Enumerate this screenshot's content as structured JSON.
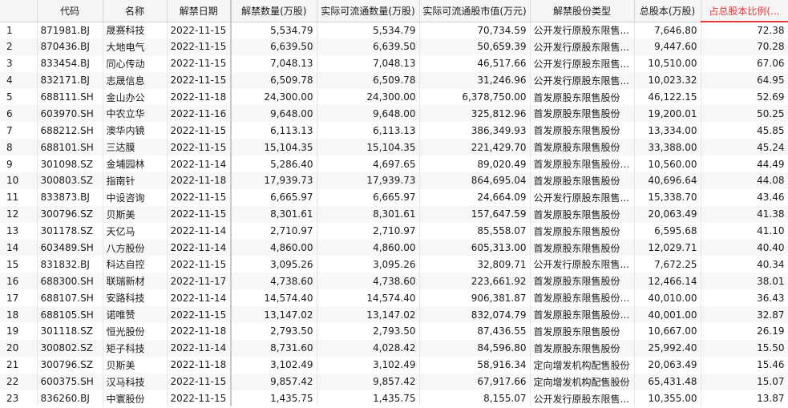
{
  "headers": [
    "",
    "代码",
    "名称",
    "解禁日期",
    "解禁数量(万股)",
    "实际可流通数量(万股)",
    "实际可流通股市值(万元)",
    "解禁股份类型",
    "总股本(万股)",
    "占总股本比例(..."
  ],
  "rows": [
    [
      "1",
      "871981.BJ",
      "晟赛科技",
      "2022-11-15",
      "5,534.79",
      "5,534.79",
      "70,734.59",
      "公开发行原股东限售...",
      "7,646.80",
      "72.38"
    ],
    [
      "2",
      "870436.BJ",
      "大地电气",
      "2022-11-15",
      "6,639.50",
      "6,639.50",
      "50,659.39",
      "公开发行原股东限售...",
      "9,447.60",
      "70.28"
    ],
    [
      "3",
      "833454.BJ",
      "同心传动",
      "2022-11-15",
      "7,048.13",
      "7,048.13",
      "46,517.66",
      "公开发行原股东限售...",
      "10,510.00",
      "67.06"
    ],
    [
      "4",
      "832171.BJ",
      "志晟信息",
      "2022-11-15",
      "6,509.78",
      "6,509.78",
      "31,246.96",
      "公开发行原股东限售...",
      "10,023.32",
      "64.95"
    ],
    [
      "5",
      "688111.SH",
      "金山办公",
      "2022-11-18",
      "24,300.00",
      "24,300.00",
      "6,378,750.00",
      "首发原股东限售股份",
      "46,122.15",
      "52.69"
    ],
    [
      "6",
      "603970.SH",
      "中农立华",
      "2022-11-16",
      "9,648.00",
      "9,648.00",
      "325,812.96",
      "首发原股东限售股份",
      "19,200.01",
      "50.25"
    ],
    [
      "7",
      "688212.SH",
      "澳华内镜",
      "2022-11-15",
      "6,113.13",
      "6,113.13",
      "386,349.93",
      "首发原股东限售股份",
      "13,334.00",
      "45.85"
    ],
    [
      "8",
      "688101.SH",
      "三达膜",
      "2022-11-15",
      "15,104.35",
      "15,104.35",
      "221,429.70",
      "首发原股东限售股份",
      "33,388.00",
      "45.24"
    ],
    [
      "9",
      "301098.SZ",
      "金埔园林",
      "2022-11-14",
      "5,286.40",
      "4,697.65",
      "89,020.49",
      "首发原股东限售股份,...",
      "10,560.00",
      "44.49"
    ],
    [
      "10",
      "300803.SZ",
      "指南针",
      "2022-11-18",
      "17,939.73",
      "17,939.73",
      "864,695.04",
      "首发原股东限售股份",
      "40,696.64",
      "44.08"
    ],
    [
      "11",
      "833873.BJ",
      "中设咨询",
      "2022-11-15",
      "6,665.97",
      "6,665.97",
      "24,664.09",
      "公开发行原股东限售...",
      "15,338.70",
      "43.46"
    ],
    [
      "12",
      "300796.SZ",
      "贝斯美",
      "2022-11-15",
      "8,301.61",
      "8,301.61",
      "157,647.59",
      "首发原股东限售股份",
      "20,063.49",
      "41.38"
    ],
    [
      "13",
      "301178.SZ",
      "天亿马",
      "2022-11-14",
      "2,710.97",
      "2,710.97",
      "85,558.07",
      "首发原股东限售股份",
      "6,595.68",
      "41.10"
    ],
    [
      "14",
      "603489.SH",
      "八方股份",
      "2022-11-14",
      "4,860.00",
      "4,860.00",
      "605,313.00",
      "首发原股东限售股份",
      "12,029.71",
      "40.40"
    ],
    [
      "15",
      "831832.BJ",
      "科达自控",
      "2022-11-15",
      "3,095.26",
      "3,095.26",
      "32,809.71",
      "公开发行原股东限售...",
      "7,672.25",
      "40.34"
    ],
    [
      "16",
      "688300.SH",
      "联瑞新材",
      "2022-11-17",
      "4,738.60",
      "4,738.60",
      "223,661.92",
      "首发原股东限售股份",
      "12,466.14",
      "38.01"
    ],
    [
      "17",
      "688107.SH",
      "安路科技",
      "2022-11-14",
      "14,574.40",
      "14,574.40",
      "906,381.87",
      "首发原股东限售股份,...",
      "40,010.00",
      "36.43"
    ],
    [
      "18",
      "688105.SH",
      "诺唯赞",
      "2022-11-15",
      "13,147.02",
      "13,147.02",
      "832,074.79",
      "首发原股东限售股份,...",
      "40,001.00",
      "32.87"
    ],
    [
      "19",
      "301118.SZ",
      "恒光股份",
      "2022-11-18",
      "2,793.50",
      "2,793.50",
      "87,436.55",
      "首发原股东限售股份",
      "10,667.00",
      "26.19"
    ],
    [
      "20",
      "300802.SZ",
      "矩子科技",
      "2022-11-14",
      "8,731.60",
      "4,028.42",
      "84,596.80",
      "首发原股东限售股份",
      "25,992.40",
      "15.50"
    ],
    [
      "21",
      "300796.SZ",
      "贝斯美",
      "2022-11-18",
      "3,102.49",
      "3,102.49",
      "58,916.34",
      "定向增发机构配售股份",
      "20,063.49",
      "15.46"
    ],
    [
      "22",
      "600375.SH",
      "汉马科技",
      "2022-11-15",
      "9,857.42",
      "9,857.42",
      "67,917.66",
      "定向增发机构配售股份",
      "65,431.48",
      "15.07"
    ],
    [
      "23",
      "836260.BJ",
      "中寰股份",
      "2022-11-15",
      "1,435.75",
      "1,435.75",
      "8,155.07",
      "公开发行原股东限售...",
      "10,355.00",
      "13.87"
    ]
  ],
  "colors": {
    "sorted_header": "#e23a3a"
  }
}
